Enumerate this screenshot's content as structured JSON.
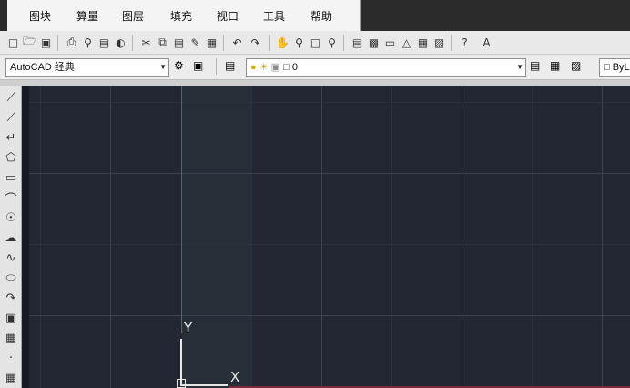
{
  "menu": {
    "items": [
      "图块",
      "算量",
      "图层",
      "填充",
      "视口",
      "工具",
      "帮助"
    ]
  },
  "toolbar": {
    "icons": [
      "new-file",
      "open-file",
      "save",
      "print",
      "plot-preview",
      "publish",
      "3d-print",
      "cut",
      "copy",
      "paste",
      "match-properties",
      "block-editor",
      "undo",
      "redo",
      "pan",
      "zoom-realtime",
      "zoom-window",
      "zoom-previous",
      "properties",
      "design-center",
      "tool-palettes",
      "sheet-set",
      "markup",
      "calculator",
      "help",
      "text-style"
    ]
  },
  "workspace": {
    "selected": "AutoCAD 经典"
  },
  "layer": {
    "current": "0"
  },
  "color": {
    "current": "ByL"
  },
  "ucs": {
    "y_label": "Y",
    "x_label": "X"
  },
  "colors": {
    "canvas_bg": "#222733",
    "grid_major": "#3a4252",
    "axis_green": "#3f7a3f",
    "ucs_white": "#e6e6e6"
  }
}
